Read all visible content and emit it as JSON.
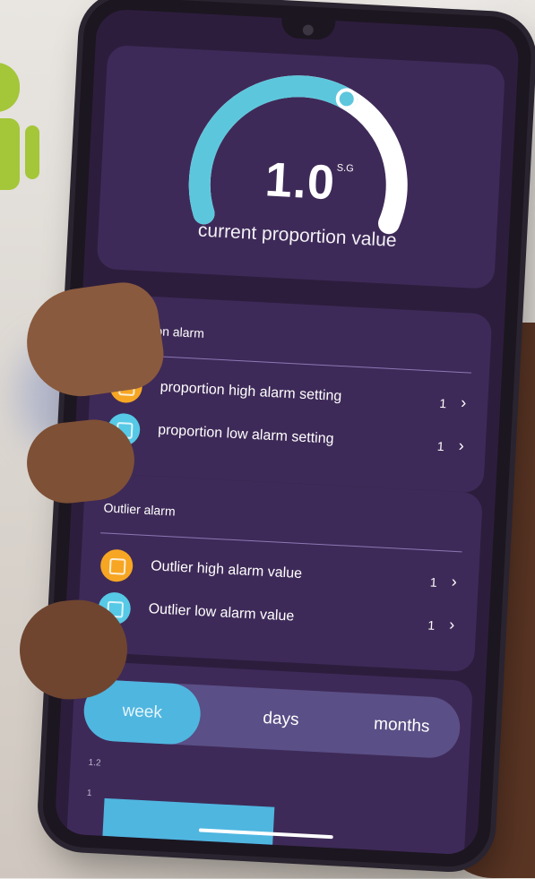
{
  "gauge": {
    "value": "1.0",
    "unit": "S.G",
    "label": "current proportion value",
    "level_fraction": 0.62,
    "colors": {
      "track": "#ffffff",
      "fill": "#5cc7dc",
      "knob": "#5cc7dc"
    }
  },
  "proportion_alarm": {
    "title": "proportion alarm",
    "items": [
      {
        "label": "proportion high alarm setting",
        "value": "1",
        "icon": "orange-alarm-icon"
      },
      {
        "label": "proportion low alarm setting",
        "value": "1",
        "icon": "cyan-alarm-icon"
      }
    ]
  },
  "outlier_alarm": {
    "title": "Outlier alarm",
    "items": [
      {
        "label": "Outlier high alarm value",
        "value": "1",
        "icon": "orange-alarm-icon"
      },
      {
        "label": "Outlier low alarm value",
        "value": "1",
        "icon": "cyan-alarm-icon"
      }
    ]
  },
  "chart": {
    "tabs": {
      "week": "week",
      "days": "days",
      "months": "months"
    },
    "selected_tab": "week",
    "y_ticks": [
      "1.2",
      "1"
    ]
  },
  "colors": {
    "screen_bg": "#2d1d3d",
    "card_bg": "#3e2a58",
    "orange": "#f6a623",
    "cyan": "#56c9e6",
    "tab_active": "#4fb6e0",
    "android_green": "#a4c639"
  },
  "icons": [
    "android-logo-icon",
    "chevron-right-icon",
    "orange-alarm-icon",
    "cyan-alarm-icon"
  ]
}
